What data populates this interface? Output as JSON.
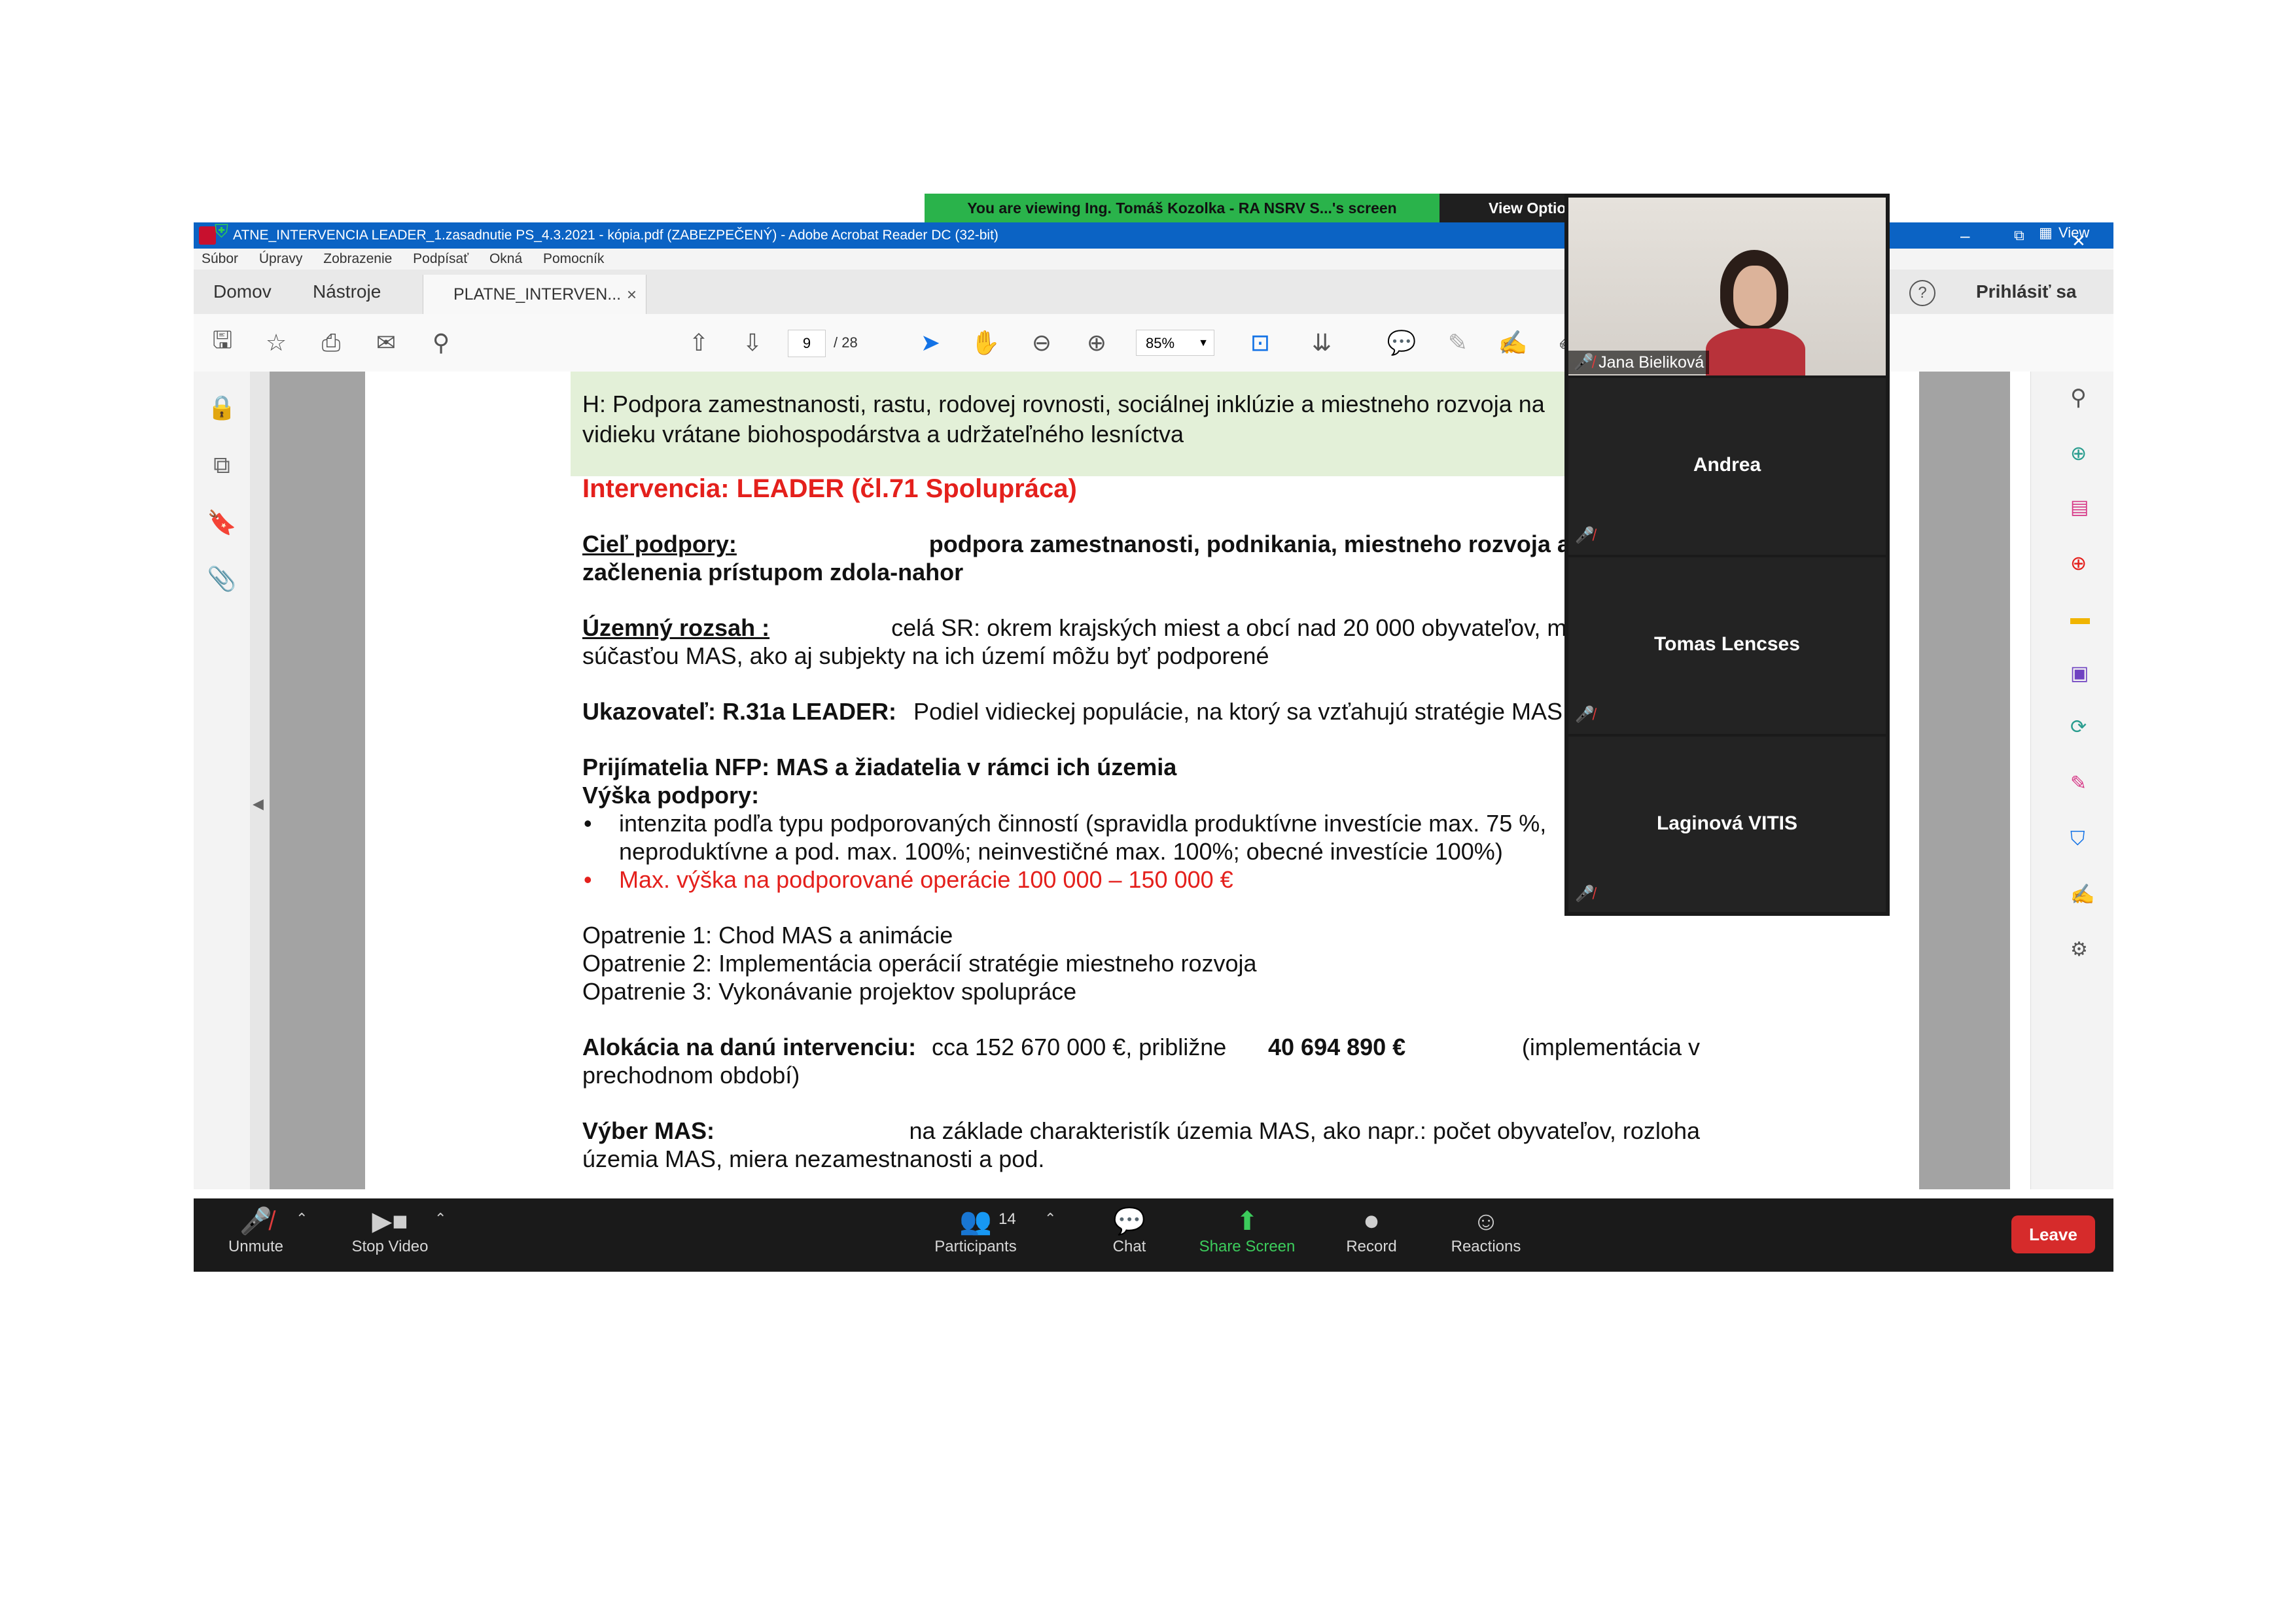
{
  "zoom_banner": {
    "viewing_text": "You are viewing Ing. Tomáš Kozolka - RA NSRV S...'s screen",
    "view_options": "View Options ⌄",
    "view_label": "View"
  },
  "acrobat": {
    "window_title": "ATNE_INTERVENCIA LEADER_1.zasadnutie PS_4.3.2021 - kópia.pdf (ZABEZPEČENÝ) - Adobe Acrobat Reader DC (32-bit)",
    "menu": [
      "Súbor",
      "Úpravy",
      "Zobrazenie",
      "Podpísať",
      "Okná",
      "Pomocník"
    ],
    "tabs": {
      "home": "Domov",
      "tools": "Nástroje",
      "document": "PLATNE_INTERVEN...",
      "close": "×"
    },
    "sign_in": "Prihlásiť sa",
    "page_current": "9",
    "page_total": "/ 28",
    "zoom": "85%"
  },
  "pdf": {
    "header_line1": "H: Podpora zamestnanosti, rastu, rodovej rovnosti, sociálnej inklúzie a miestneho rozvoja na",
    "header_line2": "vidieku vrátane biohospodárstva a udržateľného lesníctva",
    "intervention_title": "Intervencia: LEADER (čl.71 Spolupráca)",
    "goal_label": "Cieľ podpory:",
    "goal_text_1": "podpora zamestnanosti, podnikania, miestneho rozvoja a sociálneho",
    "goal_text_2": "začlenenia prístupom zdola-nahor",
    "scope_label": "Územný rozsah :",
    "scope_text_1": "celá SR: okrem krajských miest a obcí nad 20 000 obyvateľov, môžu byť však",
    "scope_text_2": "súčasťou MAS, ako aj subjekty na ich území môžu byť podporené",
    "indicator_label": "Ukazovateľ: R.31a LEADER:",
    "indicator_text": "Podiel vidieckej populácie, na ktorý sa vzťahujú stratégie MAS",
    "recipients": "Prijímatelia NFP: MAS a žiadatelia v rámci ich územia",
    "support_label": "Výška podpory:",
    "bullet1_line1": "intenzita podľa typu podporovaných činností (spravidla produktívne investície max. 75 %,",
    "bullet1_line2": "neproduktívne a pod. max. 100%; neinvestičné max. 100%; obecné investície 100%)",
    "bullet2": "Max. výška na podporované operácie 100 000 – 150 000 €",
    "measure1": "Opatrenie 1: Chod MAS a animácie",
    "measure2": "Opatrenie 2: Implementácia operácií stratégie miestneho rozvoja",
    "measure3": "Opatrenie 3: Vykonávanie projektov spolupráce",
    "allocation_label": "Alokácia na danú intervenciu:",
    "allocation_text_a": "cca 152 670 000 €,  približne",
    "allocation_amount": "40 694 890 €",
    "allocation_text_b": "(implementácia v",
    "allocation_text_2": "prechodnom období)",
    "selection_label": "Výber MAS:",
    "selection_text_1": "na základe charakteristík územia MAS, ako napr.: počet obyvateľov, rozloha",
    "selection_text_2": "územia MAS, miera nezamestnanosti a pod."
  },
  "participants_panel": {
    "video_name": "Jana Bieliková",
    "tiles": [
      "Andrea",
      "Tomas Lencses",
      "Laginová VITIS"
    ]
  },
  "zoom_toolbar": {
    "unmute": "Unmute",
    "stop_video": "Stop Video",
    "participants": "Participants",
    "participants_count": "14",
    "chat": "Chat",
    "share_screen": "Share Screen",
    "record": "Record",
    "reactions": "Reactions",
    "leave": "Leave"
  },
  "colors": {
    "accent_green": "#2ab34b",
    "title_blue": "#0b63c4",
    "red_text": "#e4201c",
    "leave_red": "#d62b2b",
    "header_band": "#e3f0d8"
  }
}
